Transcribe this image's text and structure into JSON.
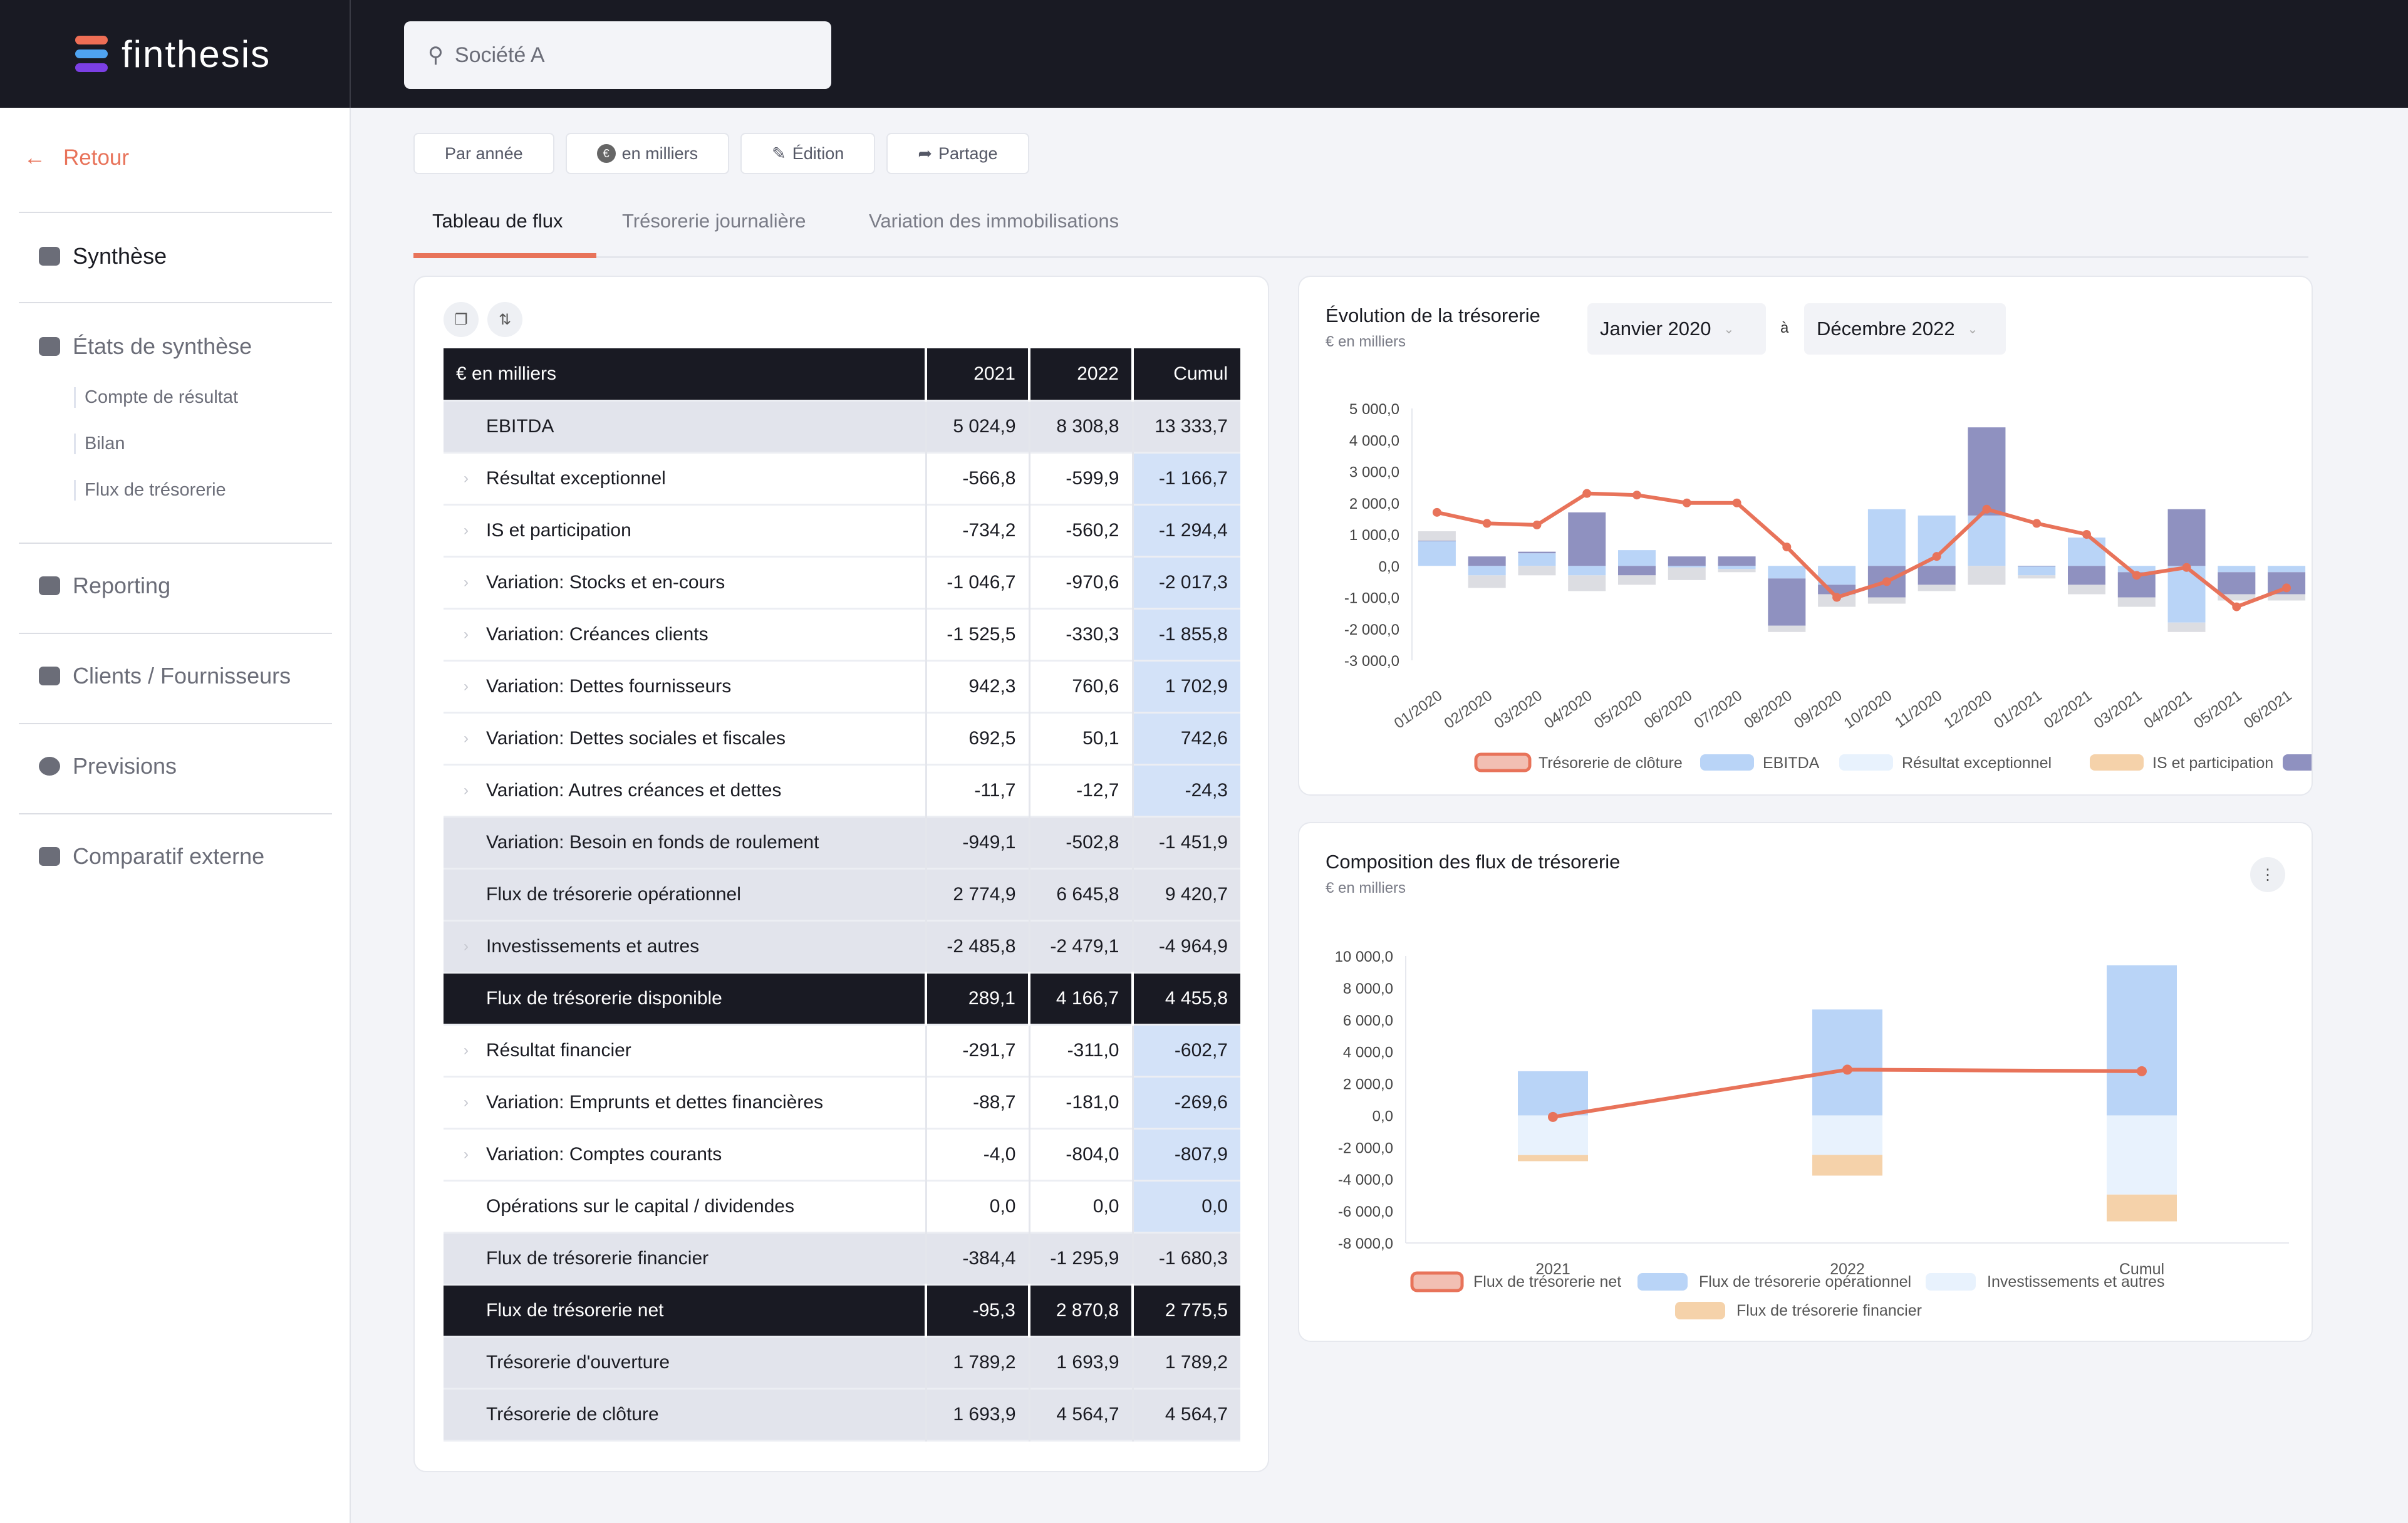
{
  "app": {
    "brand": "finthesis",
    "brand_colors": [
      "#ee6e55",
      "#4fa3f0",
      "#7b3fe4"
    ]
  },
  "search": {
    "value": "Société A"
  },
  "sidebar": {
    "back": "Retour",
    "items": [
      {
        "label": "Synthèse",
        "icon": "document-icon",
        "active": true
      },
      {
        "label": "États de synthèse",
        "icon": "bar-chart-icon",
        "sub": [
          "Compte de résultat",
          "Bilan",
          "Flux de trésorerie"
        ]
      },
      {
        "label": "Reporting",
        "icon": "wallet-icon"
      },
      {
        "label": "Clients / Fournisseurs",
        "icon": "users-icon"
      },
      {
        "label": "Previsions",
        "icon": "clock-icon"
      },
      {
        "label": "Comparatif externe",
        "icon": "briefcase-icon"
      }
    ]
  },
  "toolbar": {
    "period": "Par année",
    "unit": "en milliers",
    "edit": "Édition",
    "share": "Partage"
  },
  "tabs": [
    "Tableau de flux",
    "Trésorerie journalière",
    "Variation des immobilisations"
  ],
  "table": {
    "headers": [
      "€ en milliers",
      "2021",
      "2022",
      "Cumul"
    ],
    "rows": [
      {
        "label": "EBITDA",
        "v": [
          "5 024,9",
          "8 308,8",
          "13 333,7"
        ],
        "style": "grey",
        "exp": false
      },
      {
        "label": "Résultat exceptionnel",
        "v": [
          "-566,8",
          "-599,9",
          "-1 166,7"
        ],
        "style": "white",
        "exp": true
      },
      {
        "label": "IS et participation",
        "v": [
          "-734,2",
          "-560,2",
          "-1 294,4"
        ],
        "style": "white",
        "exp": true
      },
      {
        "label": "Variation: Stocks et en-cours",
        "v": [
          "-1 046,7",
          "-970,6",
          "-2 017,3"
        ],
        "style": "white",
        "exp": true
      },
      {
        "label": "Variation: Créances clients",
        "v": [
          "-1 525,5",
          "-330,3",
          "-1 855,8"
        ],
        "style": "white",
        "exp": true
      },
      {
        "label": "Variation: Dettes fournisseurs",
        "v": [
          "942,3",
          "760,6",
          "1 702,9"
        ],
        "style": "white",
        "exp": true
      },
      {
        "label": "Variation: Dettes sociales et fiscales",
        "v": [
          "692,5",
          "50,1",
          "742,6"
        ],
        "style": "white",
        "exp": true
      },
      {
        "label": "Variation: Autres créances et dettes",
        "v": [
          "-11,7",
          "-12,7",
          "-24,3"
        ],
        "style": "white",
        "exp": true
      },
      {
        "label": "Variation: Besoin en fonds de roulement",
        "v": [
          "-949,1",
          "-502,8",
          "-1 451,9"
        ],
        "style": "grey",
        "exp": false
      },
      {
        "label": "Flux de trésorerie opérationnel",
        "v": [
          "2 774,9",
          "6 645,8",
          "9 420,7"
        ],
        "style": "grey",
        "exp": false
      },
      {
        "label": "Investissements et autres",
        "v": [
          "-2 485,8",
          "-2 479,1",
          "-4 964,9"
        ],
        "style": "grey",
        "exp": true
      },
      {
        "label": "Flux de trésorerie disponible",
        "v": [
          "289,1",
          "4 166,7",
          "4 455,8"
        ],
        "style": "dark",
        "exp": false
      },
      {
        "label": "Résultat financier",
        "v": [
          "-291,7",
          "-311,0",
          "-602,7"
        ],
        "style": "white",
        "exp": true
      },
      {
        "label": "Variation: Emprunts et dettes financières",
        "v": [
          "-88,7",
          "-181,0",
          "-269,6"
        ],
        "style": "white",
        "exp": true
      },
      {
        "label": "Variation: Comptes courants",
        "v": [
          "-4,0",
          "-804,0",
          "-807,9"
        ],
        "style": "white",
        "exp": true
      },
      {
        "label": "Opérations sur le capital / dividendes",
        "v": [
          "0,0",
          "0,0",
          "0,0"
        ],
        "style": "white",
        "exp": false
      },
      {
        "label": "Flux de trésorerie financier",
        "v": [
          "-384,4",
          "-1 295,9",
          "-1 680,3"
        ],
        "style": "grey",
        "exp": false
      },
      {
        "label": "Flux de trésorerie net",
        "v": [
          "-95,3",
          "2 870,8",
          "2 775,5"
        ],
        "style": "dark",
        "exp": false
      },
      {
        "label": "Trésorerie d'ouverture",
        "v": [
          "1 789,2",
          "1 693,9",
          "1 789,2"
        ],
        "style": "grey",
        "exp": false
      },
      {
        "label": "Trésorerie de clôture",
        "v": [
          "1 693,9",
          "4 564,7",
          "4 564,7"
        ],
        "style": "grey",
        "exp": false
      }
    ]
  },
  "evolution": {
    "title": "Évolution de la trésorerie",
    "subtitle": "€ en milliers",
    "from": "Janvier 2020",
    "sep": "à",
    "to": "Décembre 2022"
  },
  "composition": {
    "title": "Composition des flux de trésorerie",
    "subtitle": "€ en milliers"
  },
  "chart_data": [
    {
      "type": "bar",
      "title": "Évolution de la trésorerie",
      "ylabel": "€ en milliers",
      "ylim": [
        -3000,
        5000
      ],
      "yticks": [
        "5 000,0",
        "4 000,0",
        "3 000,0",
        "2 000,0",
        "1 000,0",
        "0,0",
        "-1 000,0",
        "-2 000,0",
        "-3 000,0"
      ],
      "categories": [
        "01/2020",
        "02/2020",
        "03/2020",
        "04/2020",
        "05/2020",
        "06/2020",
        "07/2020",
        "08/2020",
        "09/2020",
        "10/2020",
        "11/2020",
        "12/2020",
        "01/2021",
        "02/2021",
        "03/2021",
        "04/2021",
        "05/2021",
        "06/2021"
      ],
      "legend": [
        "Trésorerie de clôture",
        "EBITDA",
        "Résultat exceptionnel",
        "IS et participation",
        ""
      ],
      "colors": {
        "line": "#e8735a",
        "ebitda": "#b9d4f7",
        "exc": "#e8f2fd",
        "is": "#f5d2aa",
        "bfr": "#8f91c0",
        "grey": "#dcdde2",
        "green": "#bcdcb0"
      },
      "line": [
        1700,
        1350,
        1300,
        2300,
        2250,
        2000,
        2000,
        600,
        -1000,
        -500,
        300,
        1800,
        1350,
        1000,
        -300,
        -50,
        -1300,
        -700
      ],
      "series": [
        {
          "name": "EBITDA",
          "values": [
            800,
            -300,
            400,
            -300,
            500,
            -50,
            -100,
            -400,
            -600,
            1800,
            1600,
            1600,
            -300,
            900,
            -200,
            -1800,
            -200,
            -200
          ]
        },
        {
          "name": "BFR",
          "values": [
            0,
            300,
            50,
            1700,
            -300,
            300,
            300,
            -1500,
            -300,
            -1000,
            -600,
            2800,
            0,
            -600,
            -800,
            1800,
            -700,
            -700
          ]
        },
        {
          "name": "Other",
          "values": [
            300,
            -400,
            -300,
            -500,
            -300,
            -400,
            -100,
            -200,
            -400,
            -200,
            -200,
            -600,
            -100,
            -300,
            -300,
            -300,
            -200,
            -200
          ]
        }
      ]
    },
    {
      "type": "bar",
      "title": "Composition des flux de trésorerie",
      "ylabel": "€ en milliers",
      "ylim": [
        -8000,
        10000
      ],
      "yticks": [
        "10 000,0",
        "8 000,0",
        "6 000,0",
        "4 000,0",
        "2 000,0",
        "0,0",
        "-2 000,0",
        "-4 000,0",
        "-6 000,0",
        "-8 000,0"
      ],
      "categories": [
        "2021",
        "2022",
        "Cumul"
      ],
      "legend": [
        "Flux de trésorerie net",
        "Flux de trésorerie opérationnel",
        "Investissements et autres",
        "Flux de trésorerie financier"
      ],
      "series": [
        {
          "name": "Flux de trésorerie net",
          "type": "line",
          "values": [
            -95.3,
            2870.8,
            2775.5
          ],
          "color": "#e8735a"
        },
        {
          "name": "Flux de trésorerie opérationnel",
          "values": [
            2774.9,
            6645.8,
            9420.7
          ],
          "color": "#b9d4f7"
        },
        {
          "name": "Investissements et autres",
          "values": [
            -2485.8,
            -2479.1,
            -4964.9
          ],
          "color": "#e8f2fd"
        },
        {
          "name": "Flux de trésorerie financier",
          "values": [
            -384.4,
            -1295.9,
            -1680.3
          ],
          "color": "#f5d2aa"
        }
      ]
    }
  ]
}
